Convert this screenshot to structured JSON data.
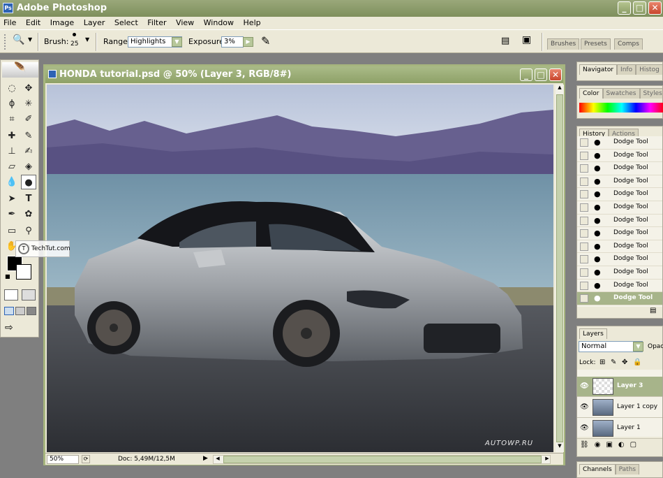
{
  "app": {
    "title": "Adobe Photoshop",
    "logo": "Ps"
  },
  "window_controls": {
    "minimize": "_",
    "maximize": "□",
    "close": "✕"
  },
  "menu": [
    "File",
    "Edit",
    "Image",
    "Layer",
    "Select",
    "Filter",
    "View",
    "Window",
    "Help"
  ],
  "options": {
    "brush_label": "Brush:",
    "brush_size": "25",
    "range_label": "Range:",
    "range_value": "Highlights",
    "exposure_label": "Exposure:",
    "exposure_value": "3%",
    "well_tabs": [
      "Brushes",
      "Presets",
      "Comps"
    ]
  },
  "document": {
    "title": "HONDA tutorial.psd @ 50% (Layer 3, RGB/8#)",
    "zoom": "50%",
    "doc_size": "Doc: 5,49M/12,5M",
    "watermark": "AUTOWP.RU",
    "overlay_badge": "TechTut.com"
  },
  "panels": {
    "navigator_tabs": [
      "Navigator",
      "Info",
      "Histog"
    ],
    "color_tabs": [
      "Color",
      "Swatches",
      "Styles"
    ],
    "history_tabs": [
      "History",
      "Actions"
    ],
    "history_items": [
      "Dodge Tool",
      "Dodge Tool",
      "Dodge Tool",
      "Dodge Tool",
      "Dodge Tool",
      "Dodge Tool",
      "Dodge Tool",
      "Dodge Tool",
      "Dodge Tool",
      "Dodge Tool",
      "Dodge Tool",
      "Dodge Tool",
      "Dodge Tool"
    ],
    "layers_tab": "Layers",
    "blend_mode": "Normal",
    "opacity_label": "Opac",
    "lock_label": "Lock:",
    "layers": [
      "Layer 3",
      "Layer 1 copy",
      "Layer 1"
    ],
    "bottom_tabs": [
      "Channels",
      "Paths"
    ]
  },
  "colors": {
    "chrome_green": "#8ea168",
    "selection": "#a7b48a",
    "foreground": "#000000",
    "background": "#ffffff"
  }
}
